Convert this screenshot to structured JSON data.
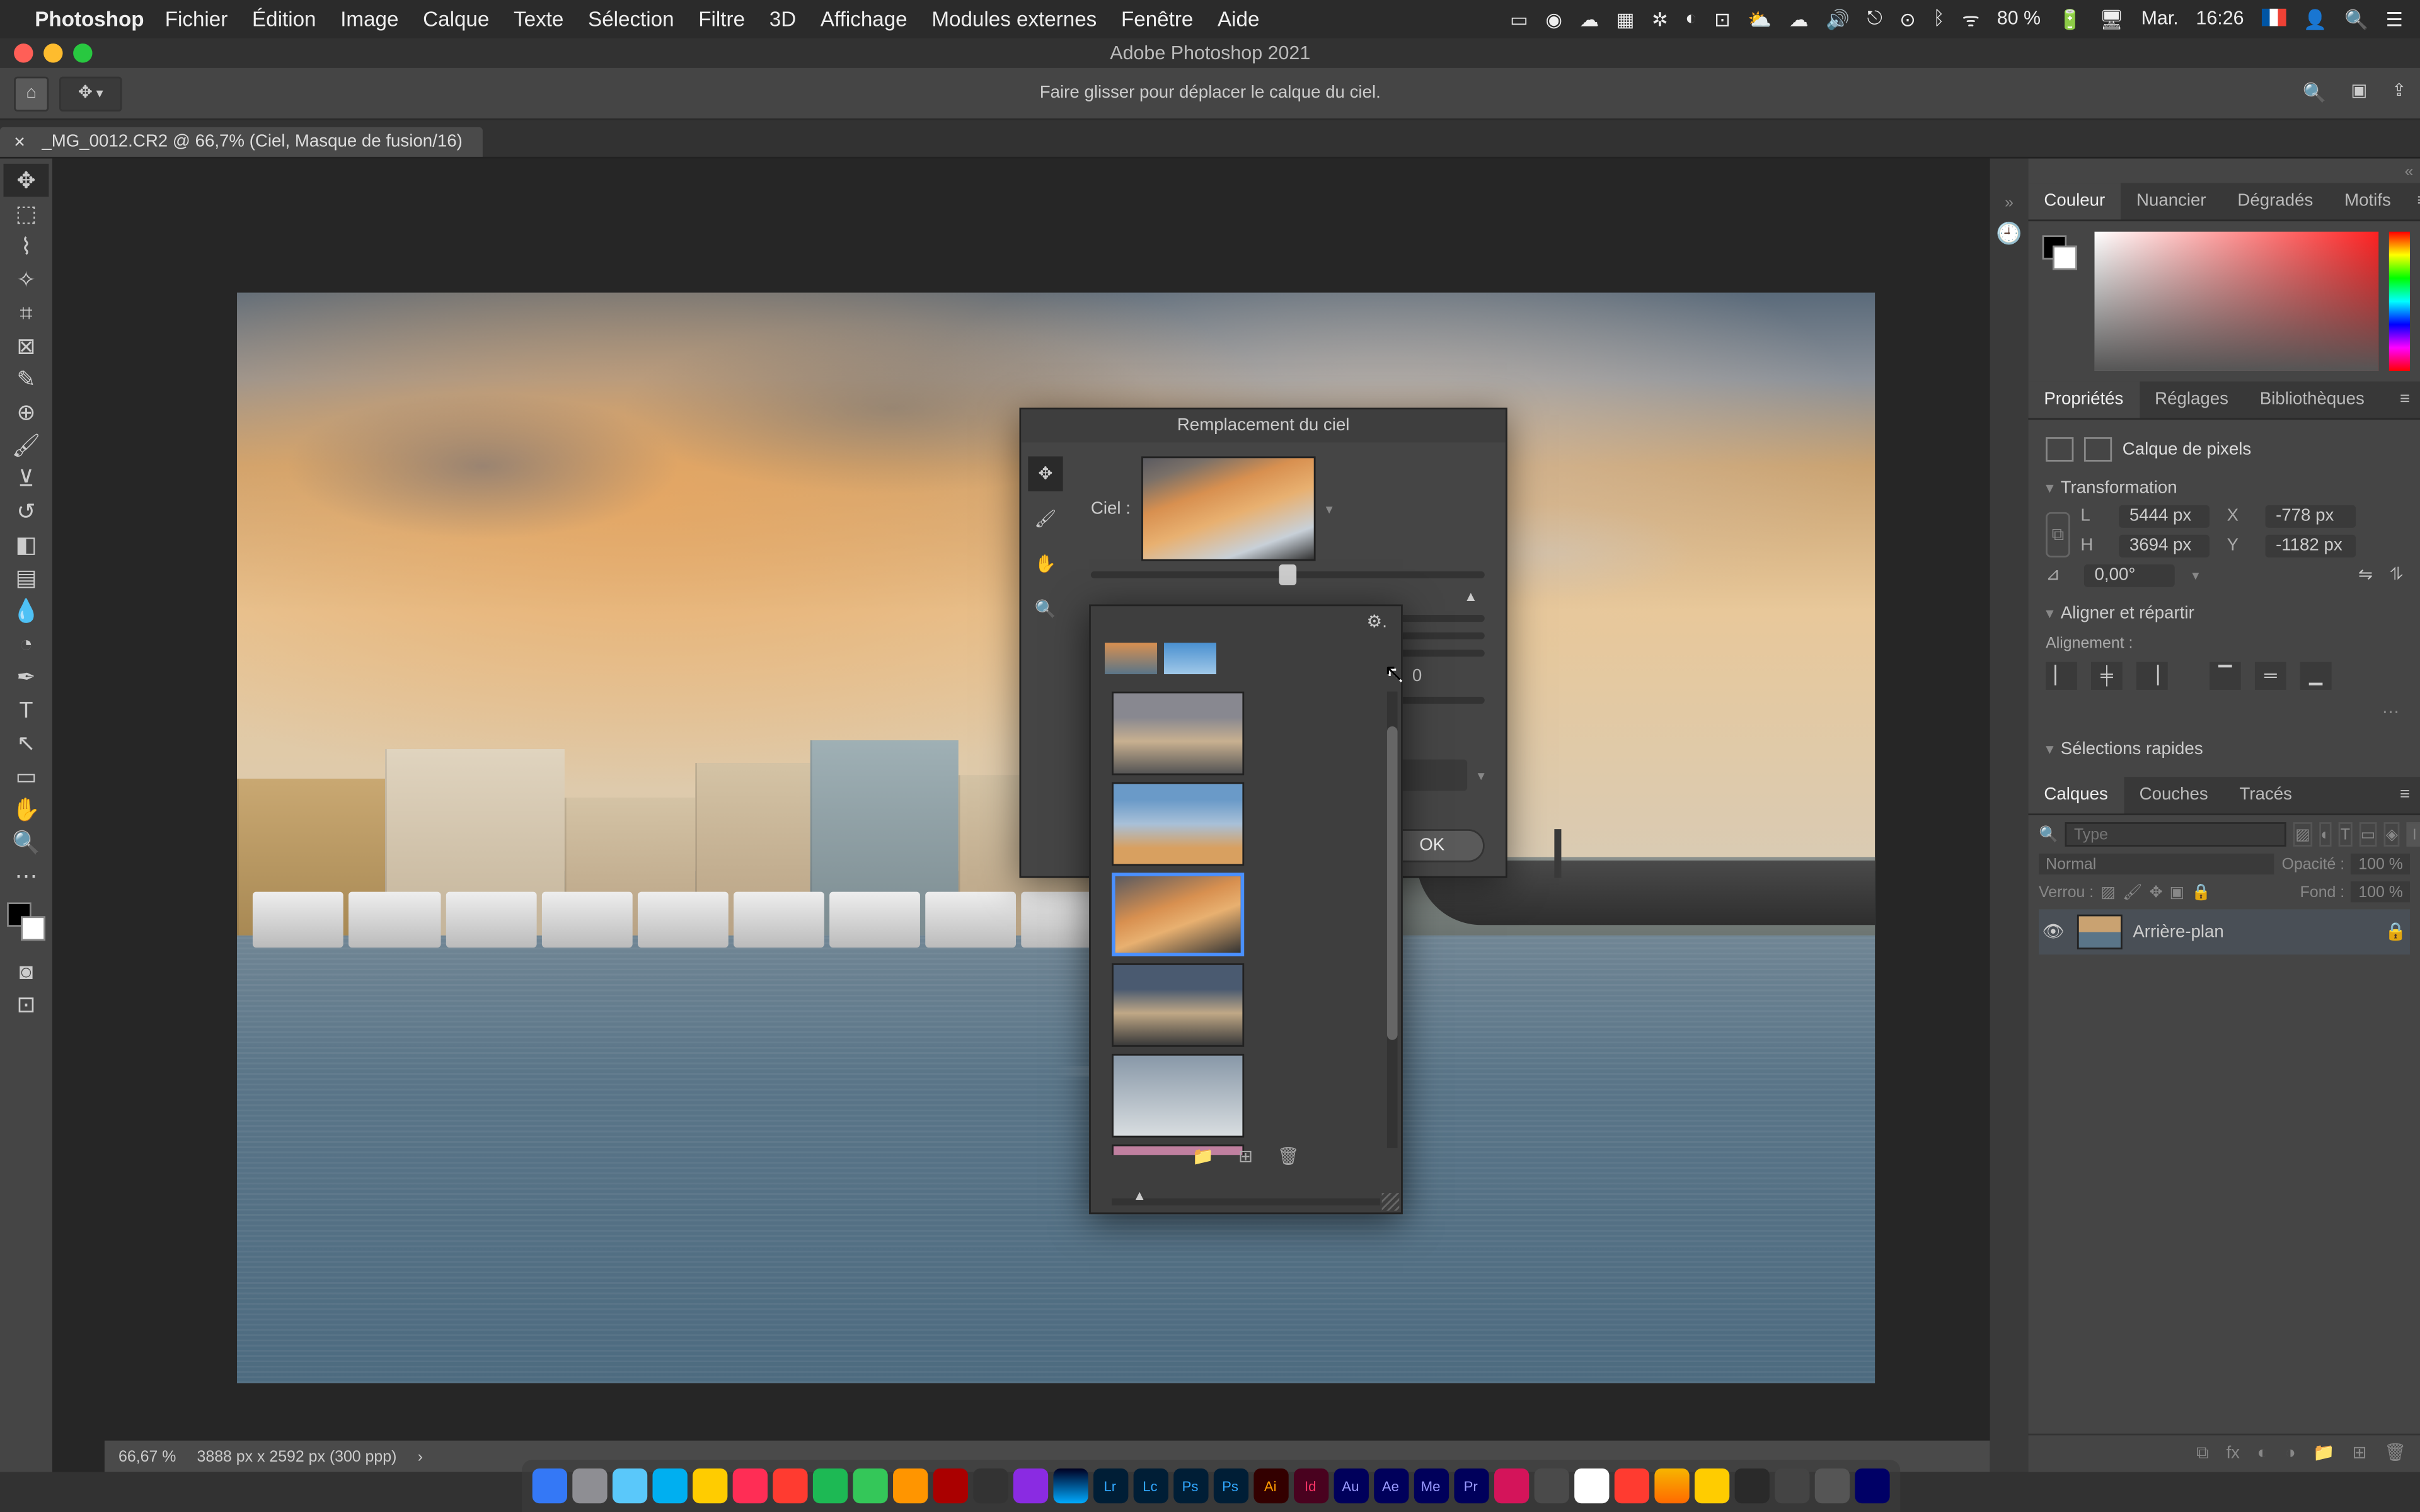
{
  "menubar": {
    "app": "Photoshop",
    "items": [
      "Fichier",
      "Édition",
      "Image",
      "Calque",
      "Texte",
      "Sélection",
      "Filtre",
      "3D",
      "Affichage",
      "Modules externes",
      "Fenêtre",
      "Aide"
    ],
    "right": {
      "wifi": "ᯤ",
      "bt": "ᛒ",
      "battery": "80 %",
      "charging": "⚡",
      "day": "Mar.",
      "time": "16:26"
    }
  },
  "titlebar": {
    "title": "Adobe Photoshop 2021"
  },
  "optbar": {
    "hint": "Faire glisser pour déplacer le calque du ciel."
  },
  "doctab": {
    "label": "_MG_0012.CR2 @ 66,7% (Ciel, Masque de fusion/16)"
  },
  "statusbar": {
    "zoom": "66,67 %",
    "info": "3888 px x 2592 px (300 ppp)"
  },
  "color_panel": {
    "tabs": [
      "Couleur",
      "Nuancier",
      "Dégradés",
      "Motifs"
    ],
    "active": 0
  },
  "props_panel": {
    "tabs": [
      "Propriétés",
      "Réglages",
      "Bibliothèques"
    ],
    "active": 0,
    "layer_type": "Calque de pixels",
    "transform_hdr": "Transformation",
    "L_lab": "L",
    "L": "5444 px",
    "X_lab": "X",
    "X": "-778 px",
    "H_lab": "H",
    "H": "3694 px",
    "Y_lab": "Y",
    "Y": "-1182 px",
    "angle_lab": "⊿",
    "angle": "0,00°",
    "align_hdr": "Aligner et répartir",
    "align_label": "Alignement :",
    "quick_hdr": "Sélections rapides"
  },
  "layers_panel": {
    "tabs": [
      "Calques",
      "Couches",
      "Tracés"
    ],
    "active": 0,
    "filter_placeholder": "Type",
    "blend": "Normal",
    "opacity_lab": "Opacité :",
    "opacity": "100 %",
    "lock_lab": "Verrou :",
    "fill_lab": "Fond :",
    "fill": "100 %",
    "layers": [
      {
        "name": "Arrière-plan",
        "locked": true
      }
    ]
  },
  "sky_dialog": {
    "title": "Remplacement du ciel",
    "sky_label": "Ciel :",
    "value_0": "0",
    "ok": "OK"
  },
  "sky_picker": {
    "selected_index": 2
  }
}
